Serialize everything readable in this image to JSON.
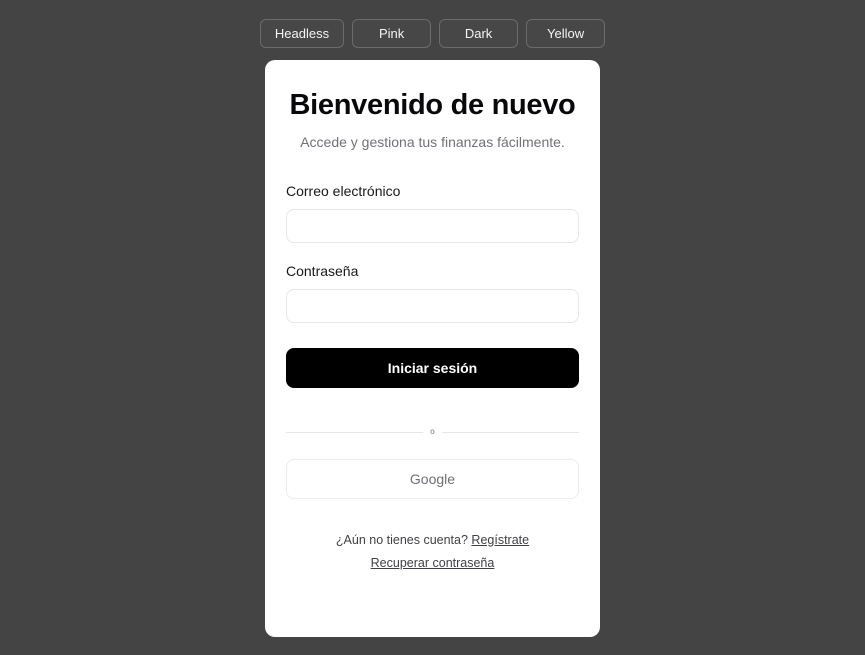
{
  "theme_switcher": {
    "buttons": [
      {
        "label": "Headless",
        "name": "theme-button-headless"
      },
      {
        "label": "Pink",
        "name": "theme-button-pink"
      },
      {
        "label": "Dark",
        "name": "theme-button-dark"
      },
      {
        "label": "Yellow",
        "name": "theme-button-yellow"
      }
    ]
  },
  "colors": {
    "page_background": "#444444",
    "card_background": "#ffffff",
    "primary_button": "#000000",
    "title_text": "#09090b",
    "muted_text": "#71717a",
    "border": "#e6e6e9",
    "theme_button_bg": "#474747",
    "theme_button_border": "#6b6b6b",
    "theme_button_text": "#f4f4f5"
  },
  "card": {
    "title": "Bienvenido de nuevo",
    "subtitle": "Accede y gestiona tus finanzas fácilmente.",
    "form": {
      "email": {
        "label": "Correo electrónico",
        "value": "",
        "placeholder": ""
      },
      "password": {
        "label": "Contraseña",
        "value": "",
        "placeholder": ""
      },
      "submit_label": "Iniciar sesión"
    },
    "divider": {
      "text": "o"
    },
    "oauth": {
      "google_label": "Google"
    },
    "footer": {
      "signup_prompt": "¿Aún no tienes cuenta?",
      "signup_link": "Regístrate",
      "recover_link": "Recuperar contraseña"
    }
  }
}
